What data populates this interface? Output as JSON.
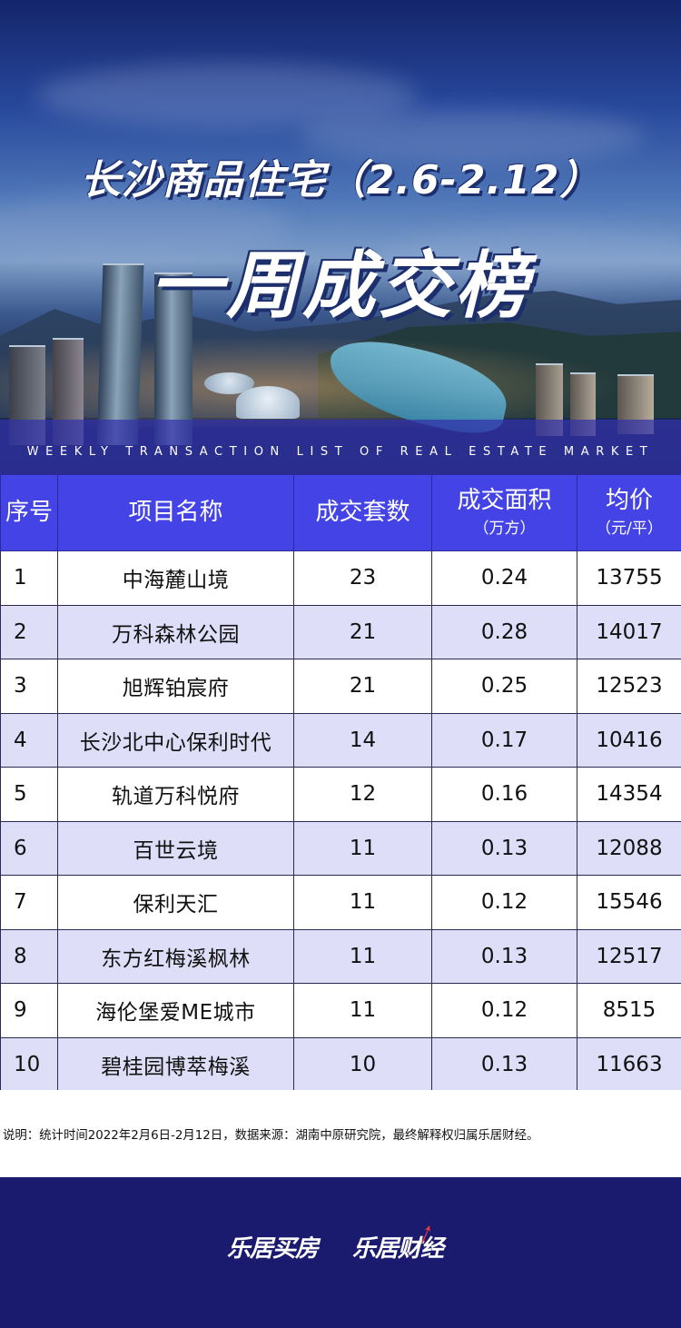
{
  "header": {
    "title_line1": "长沙商品住宅（2.6-2.12）",
    "title_line2": "一周成交榜",
    "subtitle_en": "WEEKLY TRANSACTION LIST OF REAL ESTATE MARKET"
  },
  "table": {
    "headers": {
      "index": "序号",
      "name": "项目名称",
      "count": "成交套数",
      "area": "成交面积",
      "area_unit": "（万方）",
      "price": "均价",
      "price_unit": "（元/平）"
    },
    "rows": [
      {
        "idx": "1",
        "name": "中海麓山境",
        "count": "23",
        "area": "0.24",
        "price": "13755"
      },
      {
        "idx": "2",
        "name": "万科森林公园",
        "count": "21",
        "area": "0.28",
        "price": "14017"
      },
      {
        "idx": "3",
        "name": "旭辉铂宸府",
        "count": "21",
        "area": "0.25",
        "price": "12523"
      },
      {
        "idx": "4",
        "name": "长沙北中心保利时代",
        "count": "14",
        "area": "0.17",
        "price": "10416"
      },
      {
        "idx": "5",
        "name": "轨道万科悦府",
        "count": "12",
        "area": "0.16",
        "price": "14354"
      },
      {
        "idx": "6",
        "name": "百世云境",
        "count": "11",
        "area": "0.13",
        "price": "12088"
      },
      {
        "idx": "7",
        "name": "保利天汇",
        "count": "11",
        "area": "0.12",
        "price": "15546"
      },
      {
        "idx": "8",
        "name": "东方红梅溪枫林",
        "count": "11",
        "area": "0.13",
        "price": "12517"
      },
      {
        "idx": "9",
        "name": "海伦堡爱ME城市",
        "count": "11",
        "area": "0.12",
        "price": "8515"
      },
      {
        "idx": "10",
        "name": "碧桂园博萃梅溪",
        "count": "10",
        "area": "0.13",
        "price": "11663"
      }
    ]
  },
  "note": {
    "text": "说明：统计时间2022年2月6日-2月12日，数据来源：湖南中原研究院，最终解释权归属乐居财经。"
  },
  "footer": {
    "logo_left": "乐居买房",
    "logo_right": "乐居财经"
  },
  "colors": {
    "header_bg": "#4343e6",
    "row_even_bg": "#dedef8",
    "footer_bg": "#1a1a6e",
    "band_bg": "#3232aa"
  }
}
